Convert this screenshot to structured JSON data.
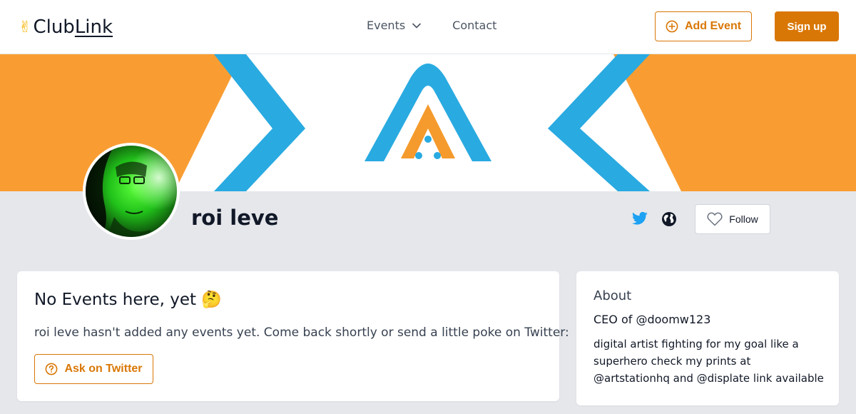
{
  "header": {
    "logo_emoji": "✌",
    "logo_club": "Club",
    "logo_link": "Link",
    "nav_events": "Events",
    "nav_contact": "Contact",
    "add_event_label": "Add Event",
    "signup_label": "Sign up"
  },
  "colors": {
    "accent": "#d97706",
    "banner_orange": "#f99d33",
    "banner_blue": "#29aae1",
    "twitter_blue": "#1da1f2",
    "page_bg": "#e5e7eb"
  },
  "profile": {
    "name": "roi leve",
    "follow_label": "Follow"
  },
  "events_card": {
    "title": "No Events here, yet 🤔",
    "message": "roi leve hasn't added any events yet. Come back shortly or send a little poke on Twitter:",
    "ask_label": "Ask on Twitter"
  },
  "about_card": {
    "title": "About",
    "headline": "CEO of @doomw123",
    "bio": "digital artist fighting for my goal like a superhero check my prints at @artstationhq and @displate link available"
  },
  "icons": {
    "nav_chevron": "chevron-down-icon",
    "add_event": "plus-circle-icon",
    "twitter": "twitter-icon",
    "website": "globe-icon",
    "follow": "heart-icon",
    "ask": "question-circle-icon"
  }
}
